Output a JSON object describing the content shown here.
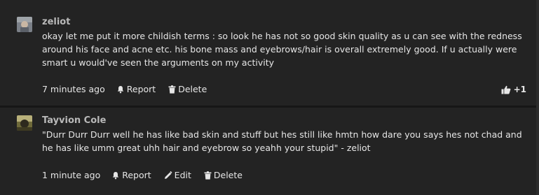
{
  "comments": [
    {
      "author": "zeliot",
      "text": "okay let me put it more childish terms : so look he has not so good skin quality as u can see with the redness around his face and acne etc. his bone mass and eyebrows/hair is overall extremely good. If u actually were smart u would've seen the arguments on my activity",
      "time": "7 minutes ago",
      "actions": {
        "report": "Report",
        "delete": "Delete"
      },
      "vote": {
        "icon": "thumbs-up-icon",
        "count": "+1"
      }
    },
    {
      "author": "Tayvion Cole",
      "text": "\"Durr Durr Durr well he has like bad skin and stuff but hes still like hmtn how dare you says hes not chad and he has like umm great uhh hair and eyebrow so yeahh your stupid\" - zeliot",
      "time": "1 minute ago",
      "actions": {
        "report": "Report",
        "edit": "Edit",
        "delete": "Delete"
      }
    }
  ],
  "colors": {
    "background": "#1e1e1e",
    "panel": "#232323",
    "text": "#e6e6e6",
    "author": "#b9b9b9"
  }
}
